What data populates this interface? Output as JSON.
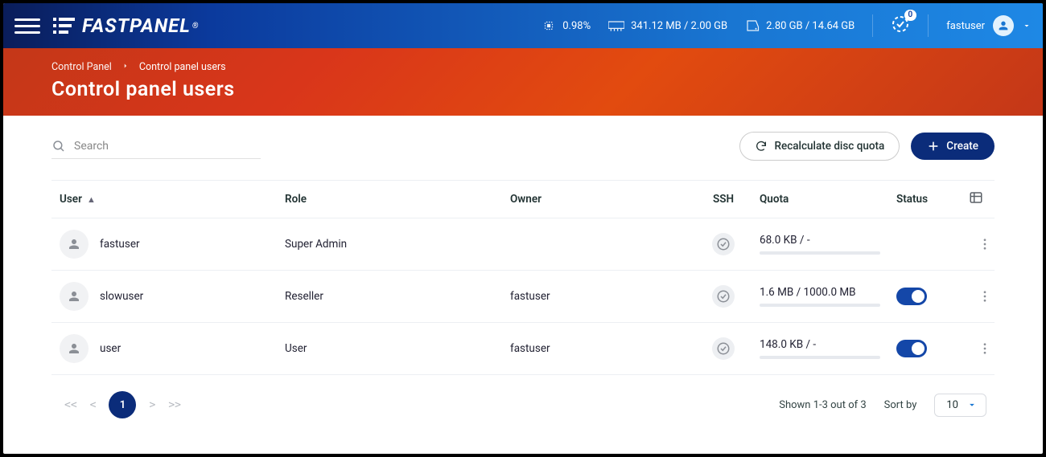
{
  "header": {
    "logo_text": "FASTPANEL",
    "cpu_percent": "0.98%",
    "memory": "341.12 MB / 2.00 GB",
    "disk": "2.80 GB / 14.64 GB",
    "badge_count": "0",
    "username": "fastuser"
  },
  "breadcrumb": {
    "root": "Control Panel",
    "current": "Control panel users"
  },
  "page_title": "Control panel users",
  "search": {
    "placeholder": "Search"
  },
  "actions": {
    "recalculate": "Recalculate disc quota",
    "create": "Create"
  },
  "columns": {
    "user": "User",
    "role": "Role",
    "owner": "Owner",
    "ssh": "SSH",
    "quota": "Quota",
    "status": "Status"
  },
  "rows": [
    {
      "user": "fastuser",
      "role": "Super Admin",
      "owner": "",
      "quota": "68.0 KB / -",
      "has_toggle": false
    },
    {
      "user": "slowuser",
      "role": "Reseller",
      "owner": "fastuser",
      "quota": "1.6 MB / 1000.0 MB",
      "has_toggle": true
    },
    {
      "user": "user",
      "role": "User",
      "owner": "fastuser",
      "quota": "148.0 KB / -",
      "has_toggle": true
    }
  ],
  "pagination": {
    "current": "1",
    "shown": "Shown 1-3 out of 3",
    "sortby_label": "Sort by",
    "sortby_value": "10"
  }
}
